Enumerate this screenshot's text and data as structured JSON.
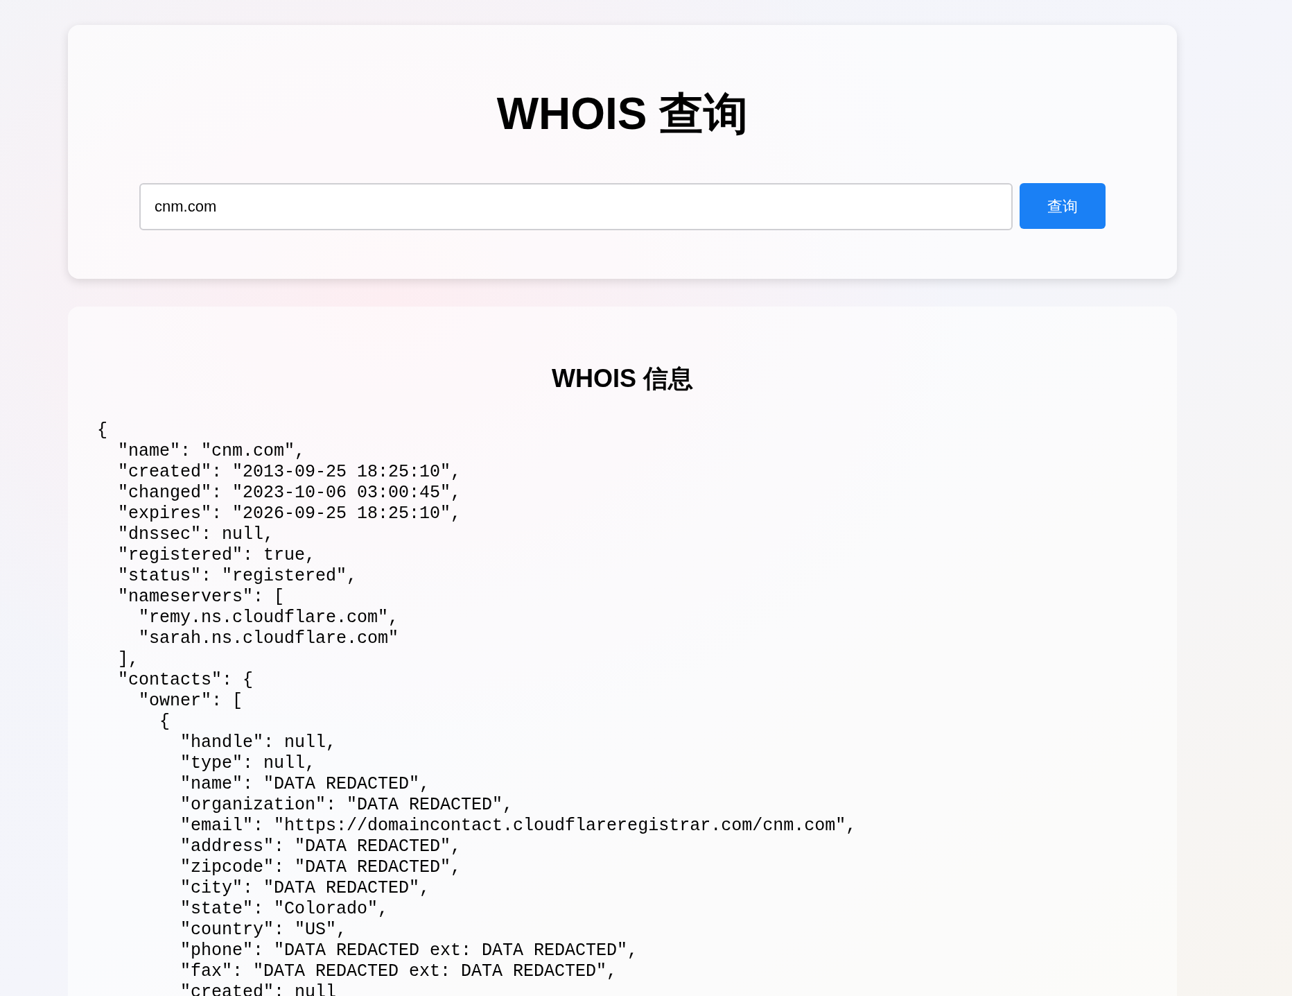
{
  "search_card": {
    "title": "WHOIS 查询",
    "domain_field": {
      "value": "cnm.com"
    },
    "submit_button": "查询"
  },
  "result_card": {
    "heading": "WHOIS 信息",
    "json_lines": [
      "{",
      "  \"name\": \"cnm.com\",",
      "  \"created\": \"2013-09-25 18:25:10\",",
      "  \"changed\": \"2023-10-06 03:00:45\",",
      "  \"expires\": \"2026-09-25 18:25:10\",",
      "  \"dnssec\": null,",
      "  \"registered\": true,",
      "  \"status\": \"registered\",",
      "  \"nameservers\": [",
      "    \"remy.ns.cloudflare.com\",",
      "    \"sarah.ns.cloudflare.com\"",
      "  ],",
      "  \"contacts\": {",
      "    \"owner\": [",
      "      {",
      "        \"handle\": null,",
      "        \"type\": null,",
      "        \"name\": \"DATA REDACTED\",",
      "        \"organization\": \"DATA REDACTED\",",
      "        \"email\": \"https://domaincontact.cloudflareregistrar.com/cnm.com\",",
      "        \"address\": \"DATA REDACTED\",",
      "        \"zipcode\": \"DATA REDACTED\",",
      "        \"city\": \"DATA REDACTED\",",
      "        \"state\": \"Colorado\",",
      "        \"country\": \"US\",",
      "        \"phone\": \"DATA REDACTED ext: DATA REDACTED\",",
      "        \"fax\": \"DATA REDACTED ext: DATA REDACTED\",",
      "        \"created\": null"
    ]
  }
}
